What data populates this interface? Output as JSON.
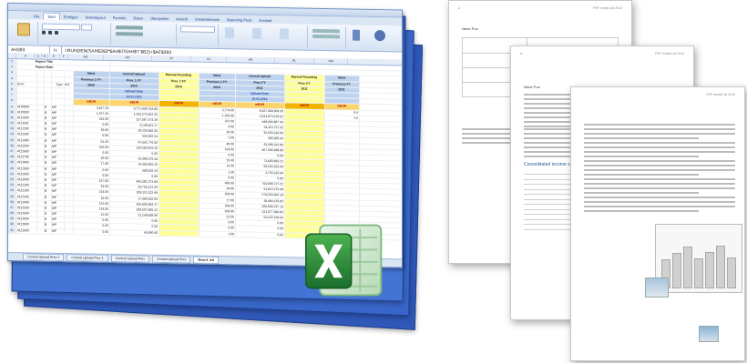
{
  "spreadsheet": {
    "ribbon_tabs": [
      "File",
      "Einfügen",
      "Seitenlayout",
      "Formeln",
      "Daten",
      "Überprüfen",
      "Ansicht",
      "Entwicklertools",
      "Reporting Pivot",
      "Acrobat"
    ],
    "active_tab": "Start",
    "name_box": "AH393",
    "fx": "fx",
    "formula": "=RUNDEN(SAH$393*$AH$7/SAH$7 $B2)+$AF$393",
    "column_headers": [
      "A",
      "C",
      "D",
      "E",
      "F",
      "AG",
      "AH",
      "AI",
      "AJ",
      "AK",
      "AL",
      "AM",
      "AN",
      "AO",
      "AP",
      "AQ"
    ],
    "report_title": "Report Title",
    "report_date": "Report Date",
    "type_label": "Type",
    "int_label": "INT",
    "desc_label": "Desc",
    "headers": [
      {
        "l1": "Value",
        "l2": "Previous 2 FY",
        "l3": "2009"
      },
      {
        "l1": "Central Upload",
        "l2": "Prev. 1 FY",
        "l3": "2010"
      },
      {
        "l1": "Manual Rounding",
        "l2": "Prev. 1 FY",
        "l3": "2010"
      },
      {
        "l1": "Value",
        "l2": "Previous 1 FY",
        "l3": "2010"
      },
      {
        "l1": "Central Upload",
        "l2": "Prev. FY",
        "l3": "2011"
      },
      {
        "l1": "Manual Rounding",
        "l2": "Prev. FY",
        "l3": "2011"
      },
      {
        "l1": "Value",
        "l2": "Previous FY",
        "l3": "2011"
      }
    ],
    "upload_date_label": "Upload Date",
    "upload_date_1": "16.01.2012",
    "upload_date_2": "16.01.2012",
    "unit_marker": "mEUR",
    "rows": [
      [
        "4100000",
        "B",
        "MP",
        "3,447.20",
        "3,771,958,744.80",
        "",
        "3,774.00",
        "8,437,909,009.50",
        "",
        "8,4"
      ],
      [
        "4110000",
        "B",
        "MP",
        "1,157.20",
        "1,165,279,461.50",
        "",
        "1,165.90",
        "1,634,879,478.02",
        "",
        "1,6"
      ],
      [
        "4111000",
        "B",
        "MP",
        "244.00",
        "237,667,574.39",
        "",
        "237.90",
        "448,004,887.94",
        "",
        ""
      ],
      [
        "4111100",
        "B",
        "MP",
        "0.00",
        "3,148,461.17",
        "",
        "4.00",
        "24,113,757.92",
        "",
        ""
      ],
      [
        "4111200",
        "B",
        "MP",
        "18.00",
        "28,229,466.30",
        "",
        "28.30",
        "32,034,130.00",
        "",
        ""
      ],
      [
        "4111300",
        "B",
        "MP",
        "0.00",
        "334,902.54",
        "",
        "1.00",
        "280,585.43",
        "",
        ""
      ],
      [
        "4111400",
        "B",
        "MP",
        "61.20",
        "47,641,776.50",
        "",
        "48.00",
        "33,280,312.89",
        "",
        ""
      ],
      [
        "4111500",
        "B",
        "MP",
        "169.00",
        "134,269,823.25",
        "",
        "134.90",
        "467,545,488.88",
        "",
        ""
      ],
      [
        "4111600",
        "B",
        "MP",
        "0.00",
        "0.00",
        "",
        "0.00",
        "0.00",
        "",
        ""
      ],
      [
        "4111700",
        "B",
        "MP",
        "18.00",
        "15,489,579.44",
        "",
        "15.90",
        "71,663,893.21",
        "",
        ""
      ],
      [
        "4111800",
        "B",
        "MP",
        "17.00",
        "14,305,855.25",
        "",
        "14.30",
        "58,163,291.03",
        "",
        ""
      ],
      [
        "4111900",
        "B",
        "MP",
        "0.00",
        "598,529.13",
        "",
        "1.30",
        "3,733,223.94",
        "",
        ""
      ],
      [
        "4111909",
        "B",
        "MP",
        "0.00",
        "0.00",
        "",
        "0.00",
        "0.00",
        "",
        ""
      ],
      [
        "4112000",
        "B",
        "MP",
        "517.00",
        "495,581,073.84",
        "",
        "496.00",
        "750,898,727.01",
        "",
        ""
      ],
      [
        "4112100",
        "B",
        "MP",
        "33.00",
        "33,756,123.59",
        "",
        "34.00",
        "51,812,373.48",
        "",
        ""
      ],
      [
        "4112200",
        "B",
        "MP",
        "214.00",
        "209,115,222.90",
        "",
        "205.00",
        "276,554,002.26",
        "",
        ""
      ],
      [
        "4112300",
        "B",
        "MP",
        "16.00",
        "17,469,502.03",
        "",
        "17.00",
        "18,464,125.83",
        "",
        ""
      ],
      [
        "4112400",
        "B",
        "MP",
        "122.00",
        "105,605,484.17",
        "",
        "106.00",
        "200,804,237.19",
        "",
        ""
      ],
      [
        "4112500",
        "B",
        "MP",
        "133.00",
        "108,557,855.12",
        "",
        "109.00",
        "123,977,696.83",
        "",
        ""
      ],
      [
        "4112600",
        "B",
        "MP",
        "21.00",
        "21,148,608.98",
        "",
        "21.00",
        "52,222,150.65",
        "",
        ""
      ],
      [
        "4112609",
        "B",
        "MP",
        "0.00",
        "0.00",
        "",
        "0.00",
        "0.00",
        "",
        ""
      ],
      [
        "4112800",
        "B",
        "MP",
        "0.00",
        "0.00",
        "",
        "0.00",
        "0.00",
        "",
        ""
      ],
      [
        "4112900",
        "B",
        "MP",
        "0.00",
        "49,090.95",
        "",
        "1.00",
        "0.00",
        "",
        ""
      ]
    ],
    "sheet_tabs": [
      "Central Upload Prev 2",
      "Central Upload Prev 1",
      "Central Upload Prev",
      "Central Upload Prev",
      "Board_Val"
    ]
  },
  "documents": {
    "doc1_header": "PKF Invest Ltd 2012",
    "doc1_section": "Neue Pos",
    "doc2_header": "PKF Invest Ltd 2012",
    "doc2_section": "Neue Pos",
    "doc2_chart_title": "Consolidated income statement",
    "doc3_header": "PKF Invest Ltd 2012"
  },
  "colors": {
    "stack_blue": "#2f58b8",
    "excel_green": "#1e7b34",
    "highlight_yellow": "#ffff99",
    "header_blue": "#bdd3ef"
  },
  "icons": [
    "excel-logo-icon"
  ]
}
